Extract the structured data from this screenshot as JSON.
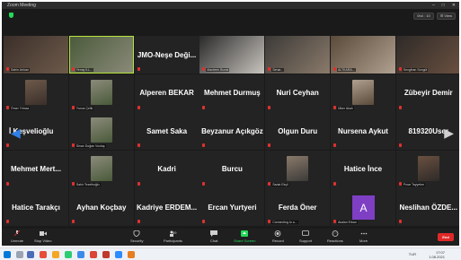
{
  "window": {
    "title": "Zoom Meeting",
    "controls": [
      "–",
      "□",
      "✕"
    ]
  },
  "view": {
    "timer": "0h4 : 10",
    "view_label": "☰ View"
  },
  "participants": [
    [
      {
        "label": "Sahin Arıkan",
        "type": "video"
      },
      {
        "label": "Yenay İLL...",
        "type": "video",
        "active": true
      },
      {
        "name": "JMO-Neşe Deği...",
        "type": "name"
      },
      {
        "label": "Mardeen Burak",
        "type": "video"
      },
      {
        "label": "Senar...",
        "type": "video"
      },
      {
        "label": "ALTKARA...",
        "type": "video"
      },
      {
        "label": "Sevgihan Songül",
        "type": "video"
      }
    ],
    [
      {
        "label": "Ömer Yılmaz",
        "type": "video"
      },
      {
        "label": "Yunus Çelik",
        "type": "video"
      },
      {
        "name": "Alperen BEKAR",
        "type": "name"
      },
      {
        "name": "Mehmet Durmuş",
        "type": "name"
      },
      {
        "name": "Nuri Ceyhan",
        "type": "name"
      },
      {
        "label": "Ülker Akalı",
        "type": "video"
      },
      {
        "name": "Zübeyir Demir",
        "type": "name"
      }
    ],
    [
      {
        "name": "İ Keşvelioğlu",
        "type": "name"
      },
      {
        "label": "Sinan Doğan Vuolaş",
        "type": "video"
      },
      {
        "name": "Samet Saka",
        "type": "name"
      },
      {
        "name": "Beyzanur Açıkgöz",
        "type": "name"
      },
      {
        "name": "Olgun Duru",
        "type": "name"
      },
      {
        "name": "Nursena Aykut",
        "type": "name"
      },
      {
        "name": "819320User",
        "type": "name"
      }
    ],
    [
      {
        "name": "Mehmet Mert...",
        "type": "name"
      },
      {
        "label": "Sahir Tezelhoğlu",
        "type": "video"
      },
      {
        "name": "Kadri",
        "type": "name"
      },
      {
        "name": "Burcu",
        "type": "name"
      },
      {
        "label": "Sadat Ekçil",
        "type": "video"
      },
      {
        "name": "Hatice İnce",
        "type": "name"
      },
      {
        "label": "Pınar Tayyebm",
        "type": "video"
      }
    ],
    [
      {
        "name": "Hatice Tarakçı",
        "type": "name"
      },
      {
        "name": "Ayhan Koçbay",
        "type": "name"
      },
      {
        "name": "Kadriye ERDEM...",
        "type": "name"
      },
      {
        "name": "Ercan Yurtyeri",
        "type": "name"
      },
      {
        "name": "Ferda Öner",
        "type": "name",
        "sub": "Connecting to a..."
      },
      {
        "label": "Akalan Erkan",
        "type": "avatar",
        "avatar": "A"
      },
      {
        "name": "Neslihan ÖZDE...",
        "type": "name"
      }
    ]
  ],
  "toolbar": {
    "unmute": "Unmute",
    "stop_video": "Stop Video",
    "security": "Security",
    "participants": "Participants",
    "participant_count": "49",
    "chat": "Chat",
    "share_screen": "Share Screen",
    "record": "Record",
    "support": "Support",
    "reactions": "Reactions",
    "more": "More",
    "end": "End"
  },
  "taskbar": {
    "time": "17:07",
    "date": "1.08.2021",
    "lang": "TUR"
  },
  "colors": {
    "accent": "#23d959",
    "end": "#e02828",
    "active_border": "#b6e33b",
    "mic_off": "#e0312f"
  }
}
